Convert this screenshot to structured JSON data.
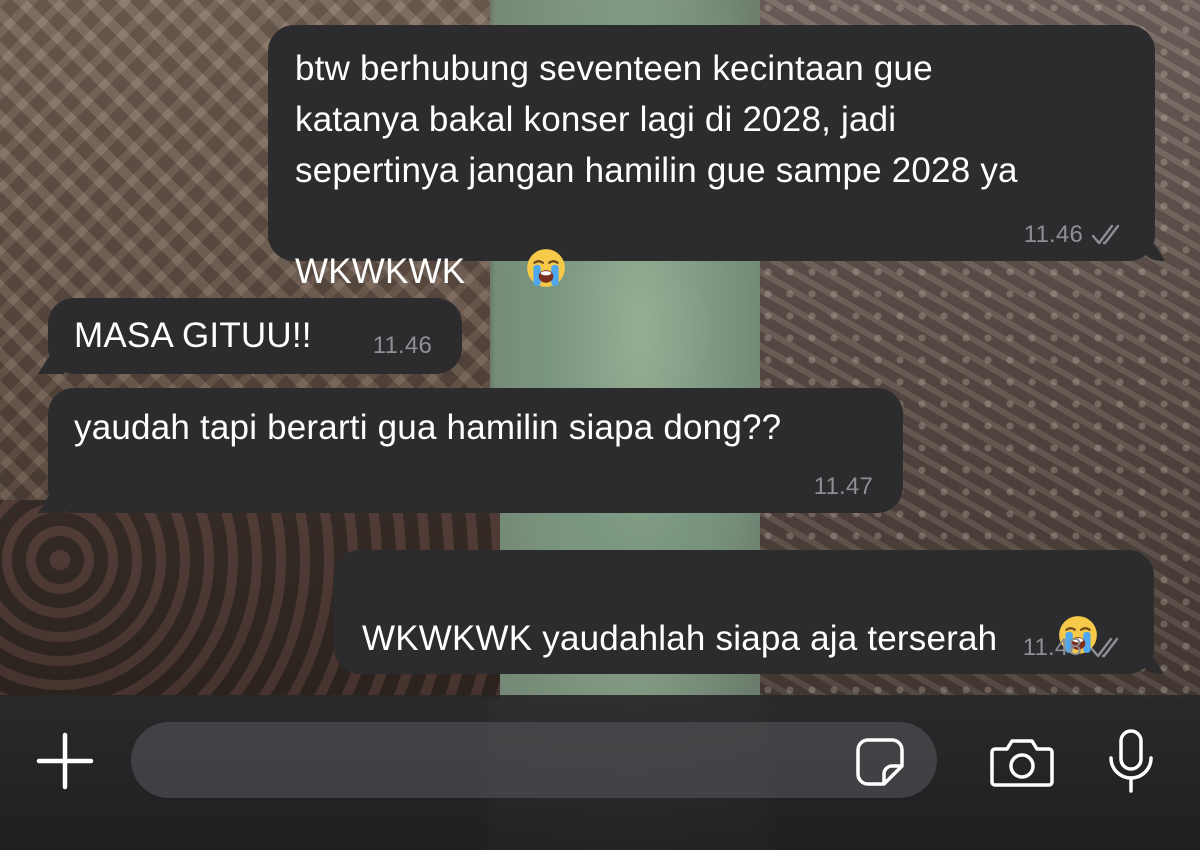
{
  "messages": [
    {
      "direction": "sent",
      "text": "btw berhubung seventeen kecintaan gue\nkatanya bakal konser lagi di 2028, jadi\nsepertinya jangan hamilin gue sampe 2028 ya\nWKWKWK",
      "emoji": "loudly-crying-face-emoji",
      "time": "11.46",
      "status": "read"
    },
    {
      "direction": "received",
      "text": "MASA GITUU!!",
      "time": "11.46"
    },
    {
      "direction": "received",
      "text": "yaudah tapi berarti gua hamilin siapa dong??",
      "time": "11.47"
    },
    {
      "direction": "sent",
      "text": "WKWKWK yaudahlah siapa aja terserah",
      "emoji": "loudly-crying-face-emoji",
      "time": "11.48",
      "status": "read"
    }
  ],
  "composer": {
    "input_value": "",
    "input_placeholder": "",
    "icons": {
      "plus": "plus-icon",
      "sticker": "sticker-icon",
      "camera": "camera-icon",
      "mic": "microphone-icon"
    }
  },
  "colors": {
    "bubble": "#2c2c2e",
    "text": "#ffffff",
    "meta": "#8e8e93",
    "composer": "#1e1e20"
  }
}
